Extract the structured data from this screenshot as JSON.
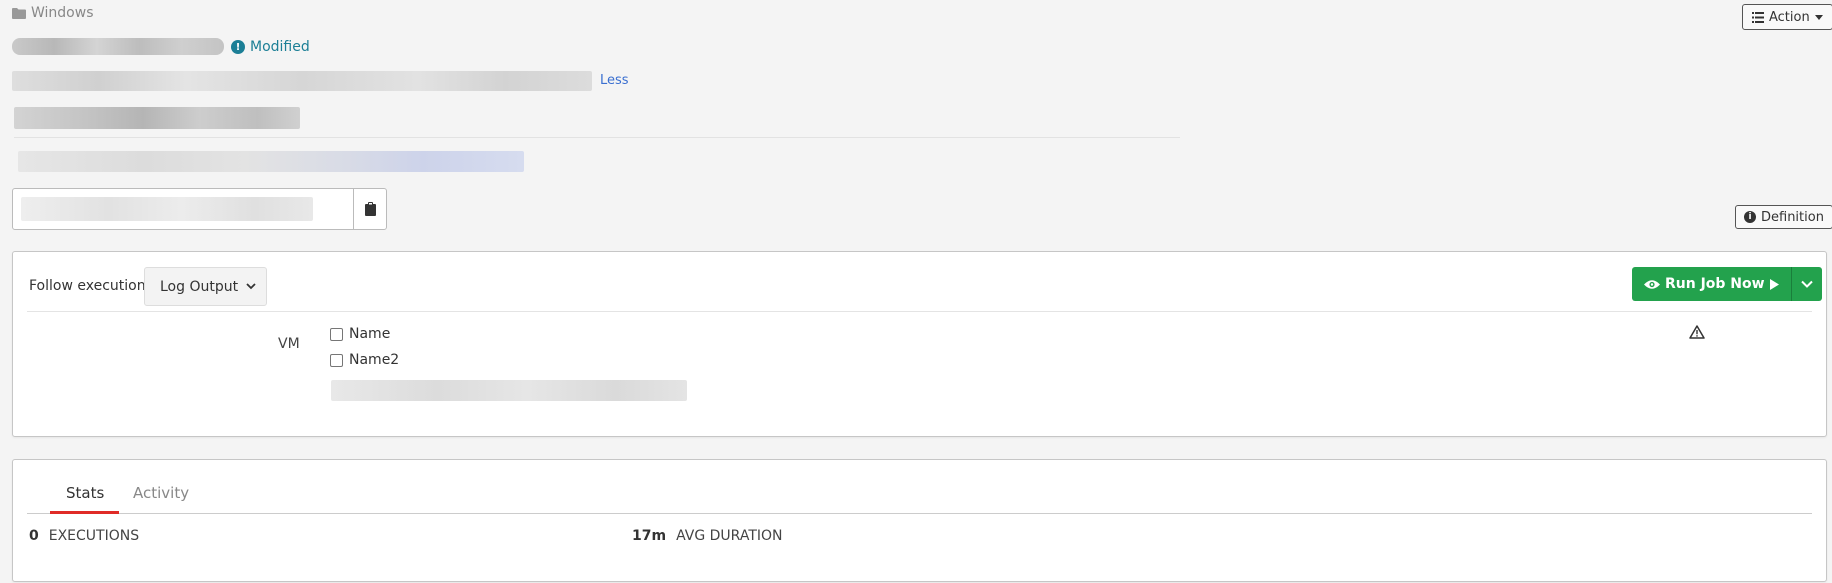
{
  "breadcrumb": {
    "icon": "folder-icon",
    "label": "Windows"
  },
  "job": {
    "modified_label": "Modified",
    "less_link": "Less"
  },
  "toolbar": {
    "action_label": "Action",
    "definition_label": "Definition"
  },
  "execution": {
    "follow_label": "Follow execution",
    "follow_select_value": "Log Output",
    "run_button_label": "Run Job Now"
  },
  "options": {
    "vm_label": "VM",
    "choices": [
      "Name",
      "Name2"
    ]
  },
  "tabs": [
    {
      "label": "Stats",
      "active": true
    },
    {
      "label": "Activity",
      "active": false
    }
  ],
  "stats": {
    "executions_value": "0",
    "executions_label": "EXECUTIONS",
    "avg_duration_value": "17m",
    "avg_duration_label": "AVG DURATION"
  },
  "colors": {
    "run_green": "#23a24d",
    "modified_teal": "#1c7f96",
    "tab_active_red": "#e02b27",
    "link_blue": "#3a6fd0"
  }
}
